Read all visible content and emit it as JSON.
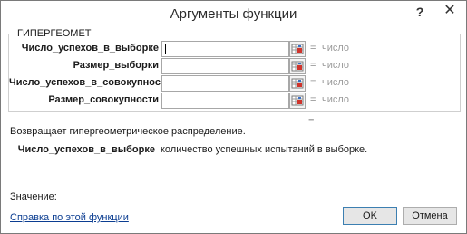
{
  "dialog": {
    "title": "Аргументы функции",
    "help_button": "?",
    "close_button": "✕"
  },
  "function": {
    "name": "ГИПЕРГЕОМЕТ",
    "arguments": [
      {
        "label": "Число_успехов_в_выборке",
        "value": "",
        "equals": "=",
        "result": "число"
      },
      {
        "label": "Размер_выборки",
        "value": "",
        "equals": "=",
        "result": "число"
      },
      {
        "label": "Число_успехов_в_совокупности",
        "value": "",
        "equals": "=",
        "result": "число"
      },
      {
        "label": "Размер_совокупности",
        "value": "",
        "equals": "=",
        "result": "число"
      }
    ],
    "total_equals": "=",
    "description": "Возвращает гипергеометрическое распределение.",
    "argument_description": {
      "name": "Число_успехов_в_выборке",
      "text": "количество успешных испытаний в выборке."
    }
  },
  "footer": {
    "value_label": "Значение:",
    "help_link": "Справка по этой функции",
    "ok_label": "OK",
    "cancel_label": "Отмена"
  }
}
